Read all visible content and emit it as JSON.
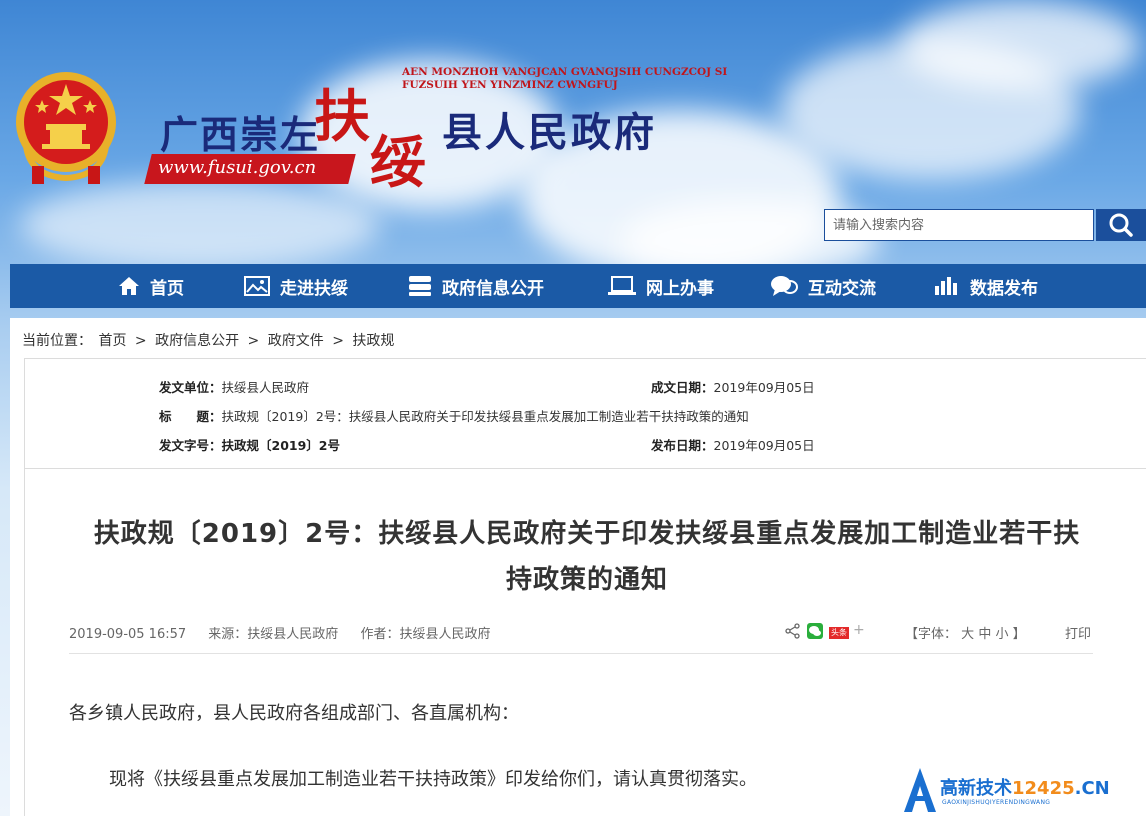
{
  "header": {
    "site_name_left": "广西崇左",
    "site_name_big1": "扶",
    "site_name_big2": "绥",
    "site_name_right": "县人民政府",
    "zhuang_line1": "AEN MONZHOH VANGJCAN GVANGJSIH CUNGZCOJ SI",
    "zhuang_line2": "FUZSUIH YEN YINZMINZ CWNGFUJ",
    "url": "www.fusui.gov.cn"
  },
  "search": {
    "placeholder": "请输入搜索内容"
  },
  "nav": {
    "items": [
      {
        "label": "首页",
        "icon": "home-icon"
      },
      {
        "label": "走进扶绥",
        "icon": "picture-icon"
      },
      {
        "label": "政府信息公开",
        "icon": "server-icon"
      },
      {
        "label": "网上办事",
        "icon": "laptop-icon"
      },
      {
        "label": "互动交流",
        "icon": "chat-icon"
      },
      {
        "label": "数据发布",
        "icon": "bar-chart-icon"
      }
    ]
  },
  "breadcrumb": {
    "prefix": "当前位置：",
    "items": [
      "首页",
      "政府信息公开",
      "政府文件",
      "扶政规"
    ],
    "separator": ">"
  },
  "meta": {
    "issuer_label": "发文单位：",
    "issuer_value": "扶绥县人民政府",
    "created_label": "成文日期：",
    "created_value": "2019年09月05日",
    "title_label": "标　　题：",
    "title_value": "扶政规〔2019〕2号：扶绥县人民政府关于印发扶绥县重点发展加工制造业若干扶持政策的通知",
    "docno_label": "发文字号：",
    "docno_value": "扶政规〔2019〕2号",
    "published_label": "发布日期：",
    "published_value": "2019年09月05日"
  },
  "article": {
    "title_line1": "扶政规〔2019〕2号：扶绥县人民政府关于印发扶绥县重点发展加工制造业若干扶",
    "title_line2": "持政策的通知",
    "datetime": "2019-09-05 16:57",
    "source": "来源：扶绥县人民政府",
    "author": "作者：扶绥县人民政府",
    "font_label": "【字体：",
    "font_large": "大",
    "font_medium": "中",
    "font_small": "小",
    "font_close": "】",
    "print_label": "打印",
    "toutiao_label": "头条",
    "para1": "各乡镇人民政府，县人民政府各组成部门、各直属机构：",
    "para2": "现将《扶绥县重点发展加工制造业若干扶持政策》印发给你们，请认真贯彻落实。"
  },
  "watermark": {
    "text": "高新技术",
    "domain": "12425",
    "suffix": ".CN",
    "pinyin": "GAOXINJISHUQIYERENDINGWANG"
  },
  "colors": {
    "nav_bg": "#1b5aa6",
    "title_red": "#c81616",
    "title_blue": "#1a2a7a"
  }
}
